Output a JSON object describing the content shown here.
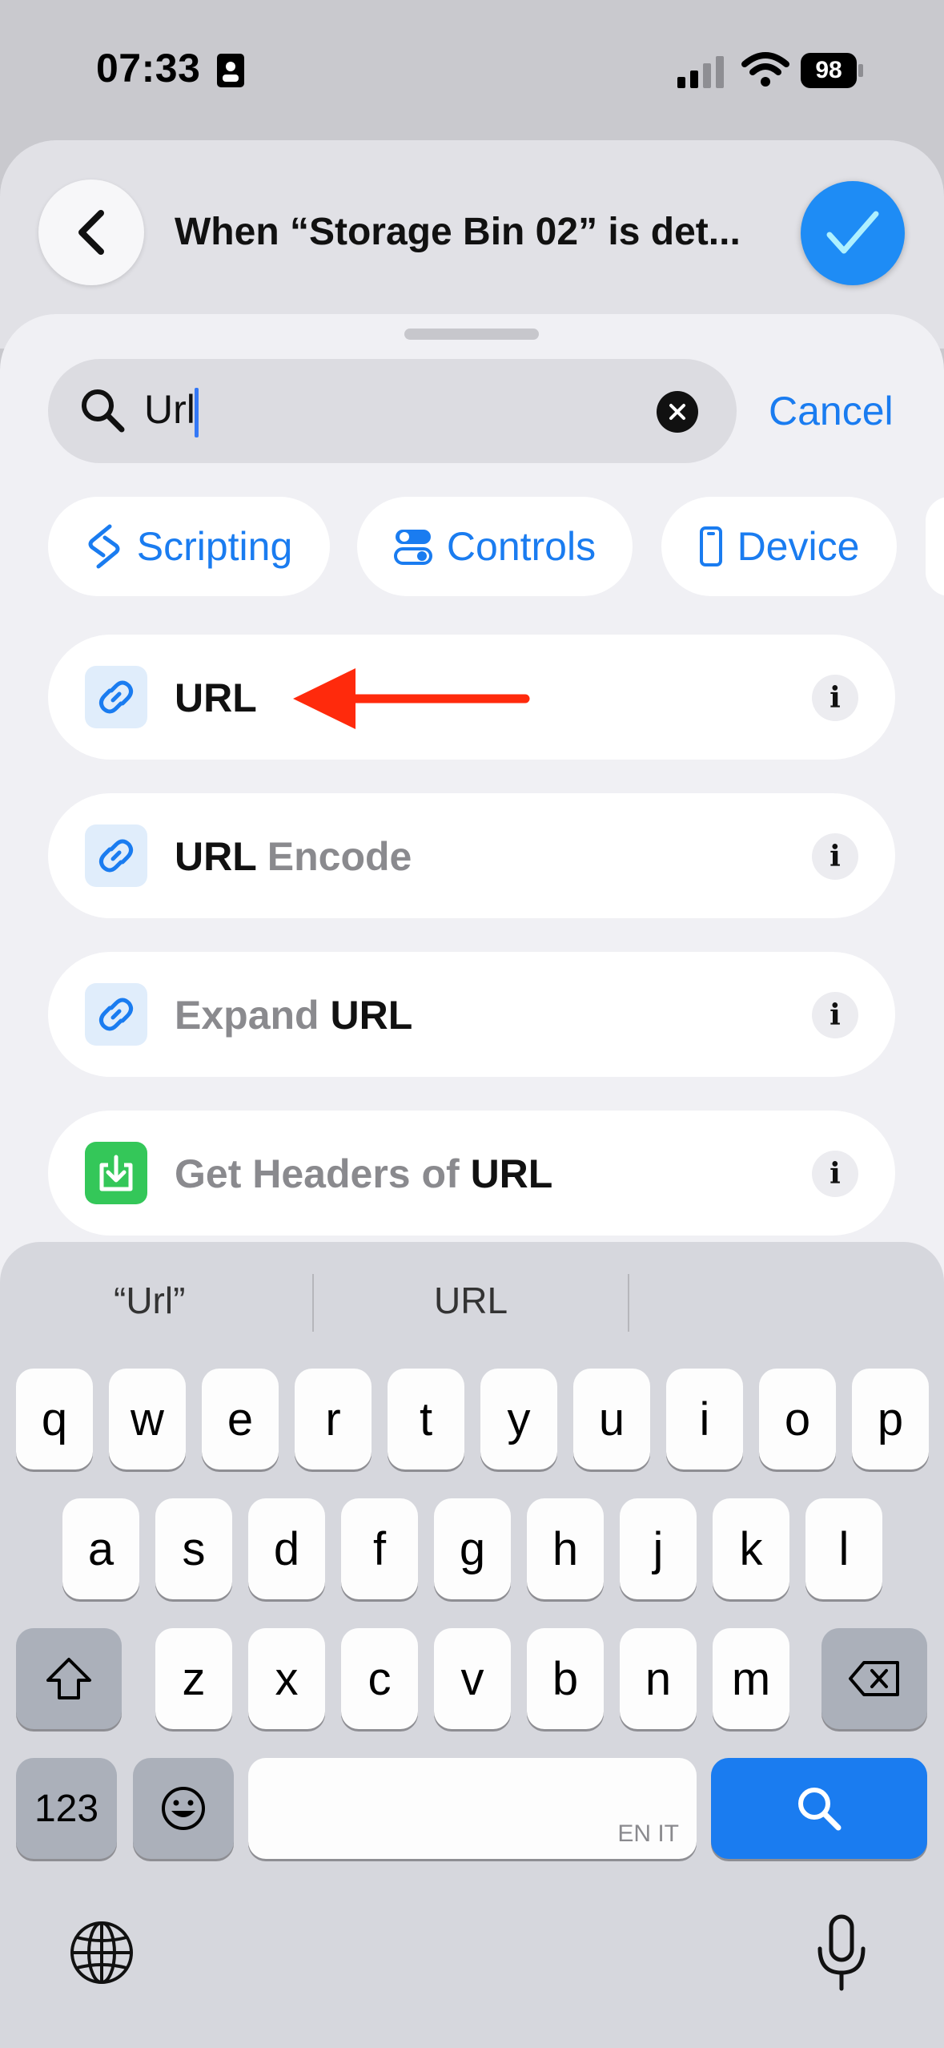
{
  "status_bar": {
    "time": "07:33",
    "battery": "98",
    "icons": [
      "id-card-icon",
      "cellular-signal-icon",
      "wifi-icon",
      "battery-icon"
    ]
  },
  "header": {
    "title": "When “Storage Bin 02” is det...",
    "back_icon": "chevron-left-icon",
    "done_icon": "checkmark-icon"
  },
  "search": {
    "value": "Url",
    "cancel_label": "Cancel"
  },
  "categories": [
    {
      "label": "Scripting",
      "icon": "scripting-icon"
    },
    {
      "label": "Controls",
      "icon": "controls-icon"
    },
    {
      "label": "Device",
      "icon": "device-icon"
    }
  ],
  "results": [
    {
      "parts": [
        {
          "text": "URL",
          "style": "strong"
        }
      ],
      "icon": "link-icon"
    },
    {
      "parts": [
        {
          "text": "URL",
          "style": "strong"
        },
        {
          "text": " Encode",
          "style": "dim"
        }
      ],
      "icon": "link-icon"
    },
    {
      "parts": [
        {
          "text": "Expand ",
          "style": "dim"
        },
        {
          "text": "URL",
          "style": "strong"
        }
      ],
      "icon": "link-icon"
    },
    {
      "parts": [
        {
          "text": "Get Headers of ",
          "style": "dim"
        },
        {
          "text": "URL",
          "style": "strong"
        }
      ],
      "icon": "download-icon"
    }
  ],
  "keyboard": {
    "suggestions": [
      "“Url”",
      "URL"
    ],
    "row1": [
      "q",
      "w",
      "e",
      "r",
      "t",
      "y",
      "u",
      "i",
      "o",
      "p"
    ],
    "row2": [
      "a",
      "s",
      "d",
      "f",
      "g",
      "h",
      "j",
      "k",
      "l"
    ],
    "row3": [
      "z",
      "x",
      "c",
      "v",
      "b",
      "n",
      "m"
    ],
    "numbers_label": "123",
    "space_label": "EN IT"
  },
  "colors": {
    "accent": "#1a7cf0",
    "done_button": "#1e8cf5",
    "arrow": "#ff2a0c",
    "headers_icon": "#34c759"
  }
}
